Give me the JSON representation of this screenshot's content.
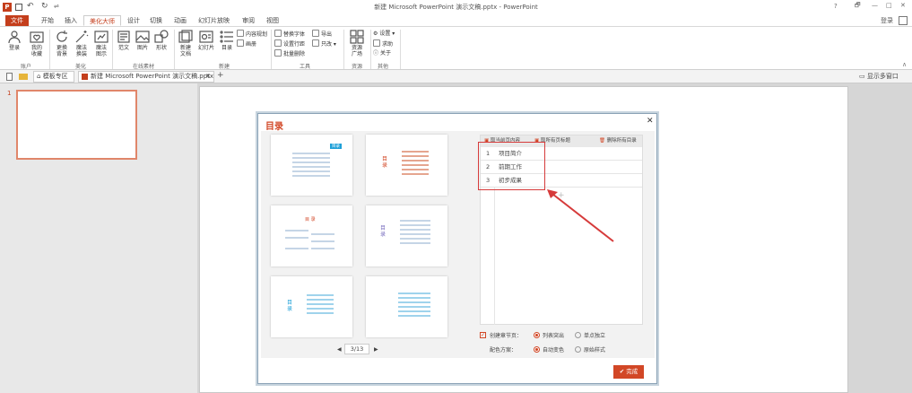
{
  "window": {
    "title": "新建 Microsoft PowerPoint 演示文稿.pptx - PowerPoint",
    "qat_sep": "⇌",
    "help": "?",
    "restore": "🗗",
    "min": "—",
    "max": "□",
    "close": "✕"
  },
  "tabs": [
    "文件",
    "开始",
    "插入",
    "美化大师",
    "设计",
    "切换",
    "动画",
    "幻灯片放映",
    "审阅",
    "视图"
  ],
  "login": "登录",
  "ribbon": {
    "buttons": {
      "login": "登录",
      "favorites": "我的\n收藏",
      "bg": "更换\n背景",
      "magic_swap": "魔法\n换装",
      "magic_img": "魔法\n图示",
      "text": "范文",
      "image": "图片",
      "shape": "形状",
      "new_doc": "新建\n文档",
      "slides": "幻灯片",
      "toc": "目录",
      "res_market": "资源\n广场"
    },
    "small": {
      "content_plan": "内容规划",
      "album": "画册",
      "replace_font": "替换字体",
      "export": "导出",
      "line_spacing": "设置行距",
      "only_change": "只改",
      "batch_delete": "批量删除",
      "settings": "设置",
      "help": "求助",
      "about": "关于"
    },
    "groups": {
      "account": "账户",
      "beautify": "美化",
      "online": "在线素材",
      "new": "新建",
      "tools": "工具",
      "resources": "资源",
      "other": "其他"
    }
  },
  "docbar": {
    "template_tab": "模板专区",
    "doc_tab": "新建 Microsoft PowerPoint 演示文稿.pptx",
    "close": "✕",
    "add": "+",
    "multi": "显示多窗口"
  },
  "slide_number": "1",
  "dialog": {
    "title": "目录",
    "close": "✕",
    "toolbar": {
      "get_content": "取当前页内容",
      "get_titles": "取所有页标题",
      "delete_all": "删除所有目录"
    },
    "rows": [
      {
        "n": "1",
        "text": "项目简介"
      },
      {
        "n": "2",
        "text": "前期工作"
      },
      {
        "n": "3",
        "text": "初步成果"
      }
    ],
    "add_plus": "+",
    "pager": {
      "prev": "◀",
      "value": "3/13",
      "next": "▶"
    },
    "create_section": {
      "label": "创建章节页：",
      "opt1": "列表突出",
      "opt2": "单点独立"
    },
    "color_scheme": {
      "label": "配色方案：",
      "opt1": "自动变色",
      "opt2": "原始样式"
    },
    "done": "完成",
    "tpl_texts": {
      "t1_badge": "目录",
      "t2_title": "目\n录",
      "t3_title": "目 录",
      "t4_title": "目\n录",
      "t5_title": "目\n录"
    }
  },
  "colors": {
    "accent": "#d24726",
    "ppt_red": "#c43e1c",
    "annot_red": "#d63b3b",
    "tpl_blue": "#1ea0d8"
  }
}
